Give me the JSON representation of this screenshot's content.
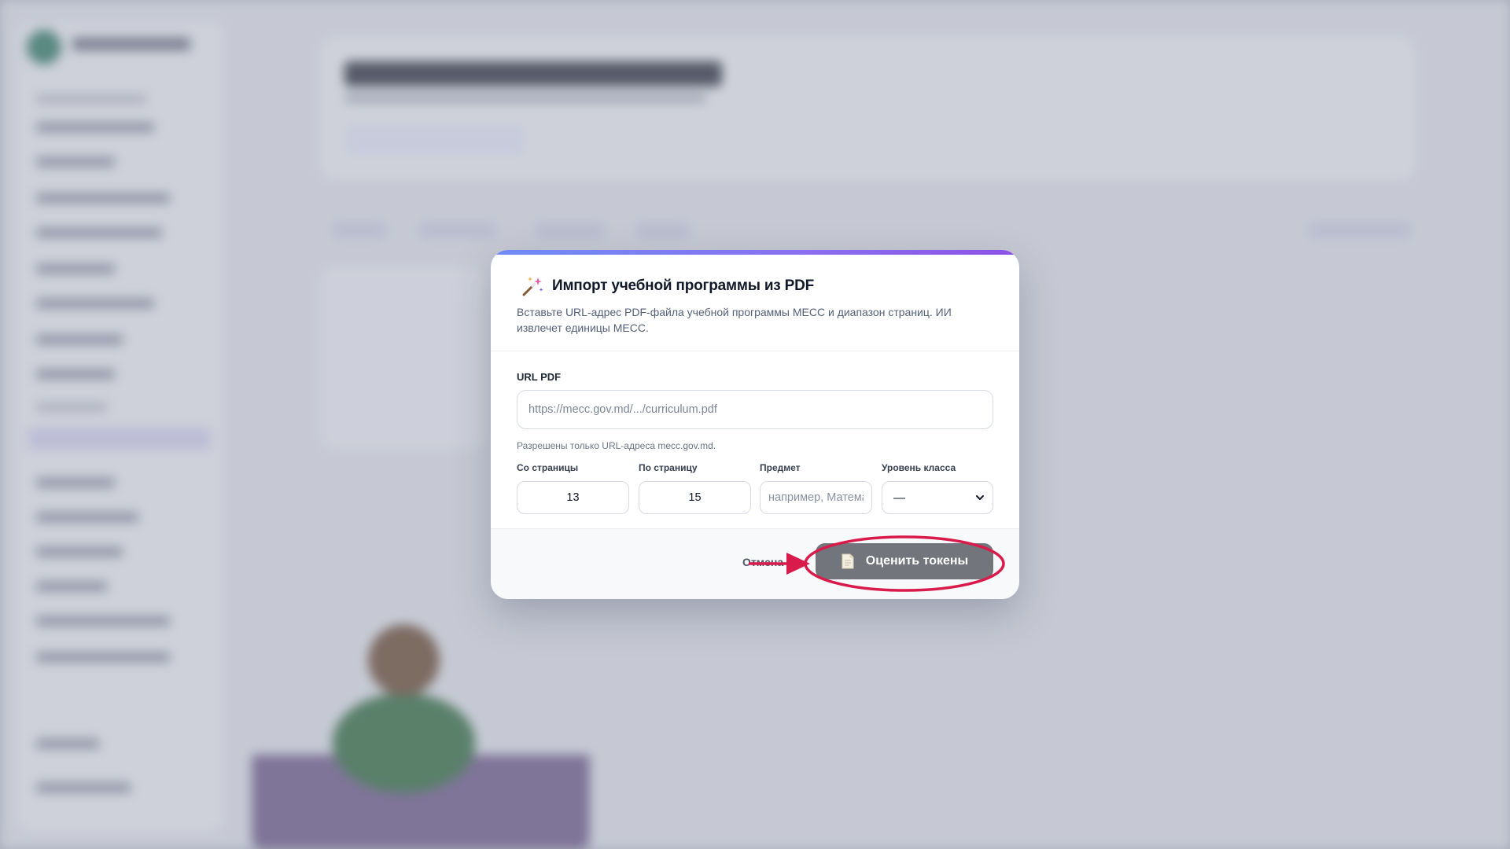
{
  "modal": {
    "title": "Импорт учебной программы из PDF",
    "description": "Вставьте URL-адрес PDF-файла учебной программы MECC и диапазон страниц. ИИ извлечет единицы MECC.",
    "url_label": "URL PDF",
    "url_placeholder": "https://mecc.gov.md/.../curriculum.pdf",
    "url_hint": "Разрешены только URL-адреса mecc.gov.md.",
    "from_page_label": "Со страницы",
    "from_page_value": "13",
    "to_page_label": "По страницу",
    "to_page_value": "15",
    "subject_label": "Предмет",
    "subject_placeholder": "например, Математика",
    "grade_label": "Уровень класса",
    "grade_value": "—",
    "cancel_label": "Отмена",
    "estimate_label": "Оценить токены",
    "icons": {
      "title_icon": "magic-wand-icon",
      "button_icon": "document-icon",
      "select_icon": "chevron-down-icon"
    }
  },
  "colors": {
    "accent_gradient_start": "#6f8df4",
    "accent_gradient_end": "#8b52e6",
    "button_bg": "#72757c",
    "annotation": "#d81b4a"
  }
}
